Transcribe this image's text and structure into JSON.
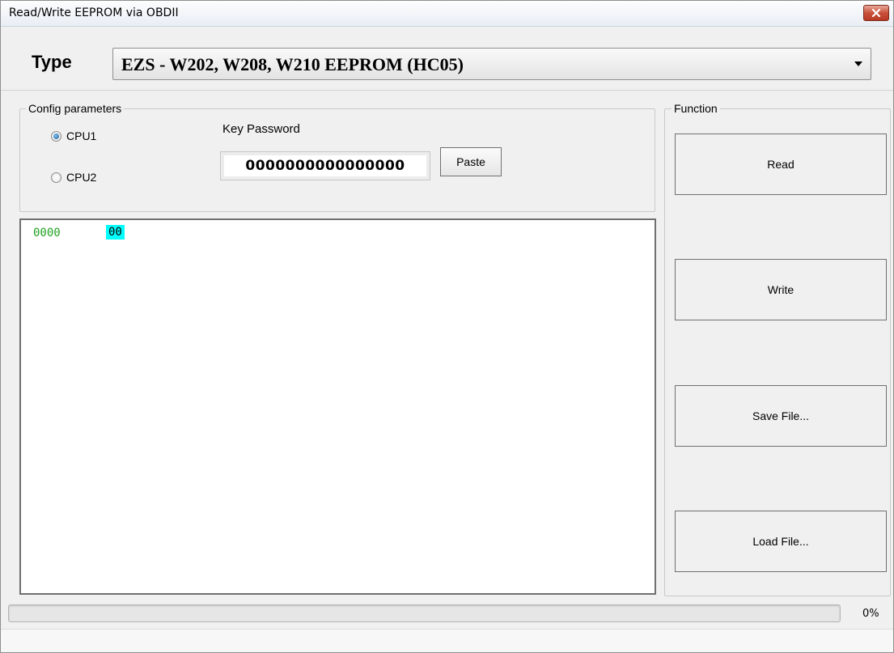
{
  "window": {
    "title": "Read/Write EEPROM via OBDII",
    "close_icon": "close-icon"
  },
  "type": {
    "label": "Type",
    "selected": "EZS - W202, W208, W210 EEPROM (HC05)"
  },
  "config": {
    "legend": "Config parameters",
    "cpu_options": [
      {
        "label": "CPU1",
        "checked": true
      },
      {
        "label": "CPU2",
        "checked": false
      }
    ],
    "key_password_label": "Key Password",
    "key_password_value": "0000000000000000",
    "paste_label": "Paste"
  },
  "hex": {
    "address": "0000",
    "byte": "00",
    "address_color": "#1fa11f",
    "highlight_color": "#00ffff"
  },
  "function": {
    "legend": "Function",
    "buttons": [
      "Read",
      "Write",
      "Save File...",
      "Load File..."
    ]
  },
  "progress": {
    "percent_text": "0%",
    "value": 0
  }
}
